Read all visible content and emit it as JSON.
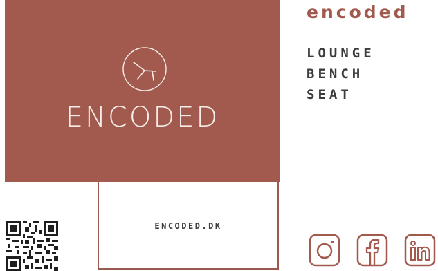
{
  "logo": {
    "wordmark": "ENCODED",
    "mark_icon": "chair-circle-logo-icon",
    "background_color": "#a15a4d",
    "text_color": "#f6ece8"
  },
  "brand": {
    "name": "encoded",
    "color": "#a15a4d"
  },
  "product_lines": [
    "LOUNGE",
    "BENCH",
    "SEAT"
  ],
  "website": {
    "text": "ENCODED.DK",
    "border_color": "#9a5a4f"
  },
  "qr_code": {
    "icon": "qr-code-icon"
  },
  "social": [
    {
      "name": "instagram",
      "icon": "instagram-icon"
    },
    {
      "name": "facebook",
      "icon": "facebook-icon"
    },
    {
      "name": "linkedin",
      "icon": "linkedin-icon"
    }
  ]
}
